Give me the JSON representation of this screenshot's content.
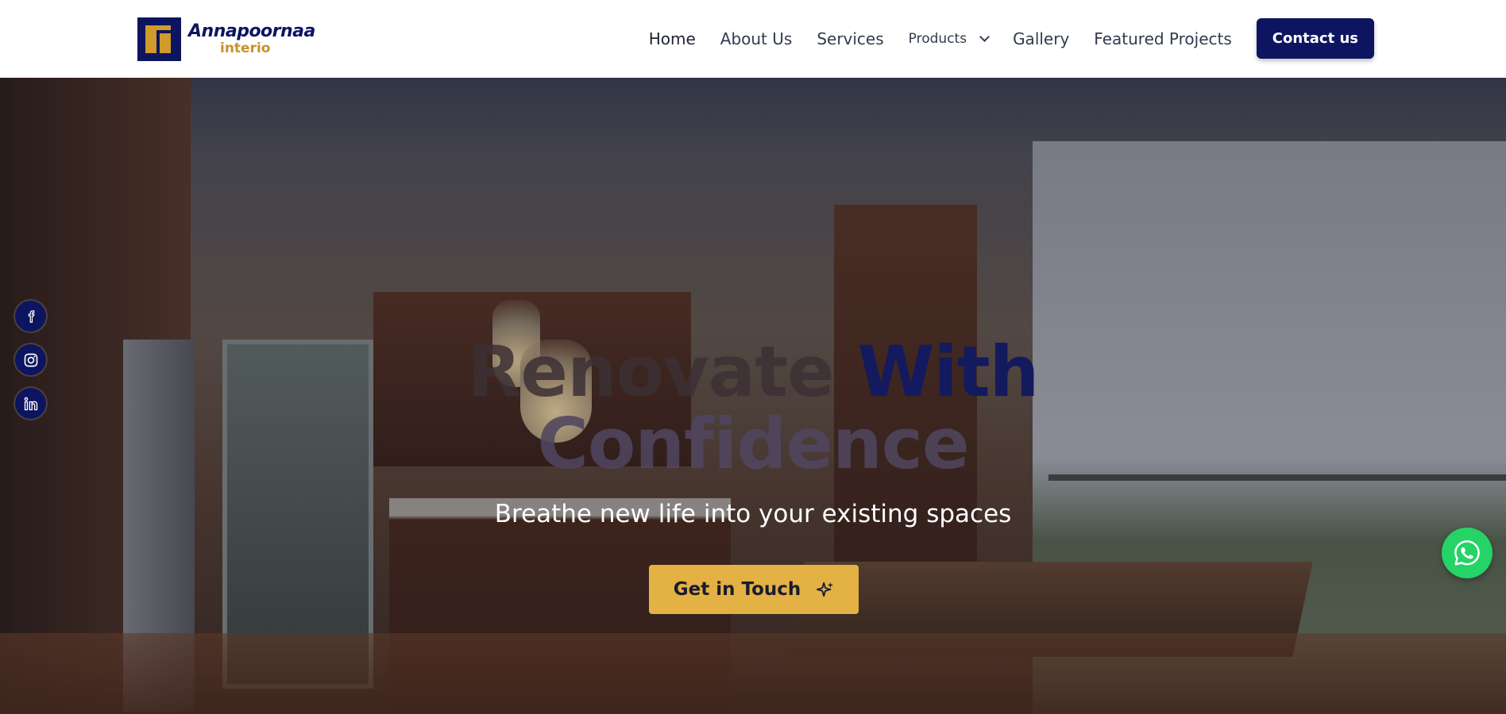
{
  "brand": {
    "name_line1": "Annapoornaa",
    "name_line2": "interio",
    "primary_color": "#0d1560",
    "accent_color": "#e3b144"
  },
  "nav": {
    "items": [
      {
        "label": "Home",
        "active": true
      },
      {
        "label": "About Us"
      },
      {
        "label": "Services"
      },
      {
        "label": "Products",
        "has_dropdown": true
      },
      {
        "label": "Gallery"
      },
      {
        "label": "Featured Projects"
      }
    ],
    "contact_label": "Contact us"
  },
  "hero": {
    "title_words_line1": [
      "Renovate",
      "With"
    ],
    "title_line2": "Confidence",
    "subtitle": "Breathe new life into your existing spaces",
    "cta_label": "Get in Touch",
    "cta_icon": "sparkle-icon"
  },
  "social": {
    "icons": [
      "facebook-icon",
      "instagram-icon",
      "linkedin-icon"
    ]
  },
  "floating": {
    "whatsapp_icon": "whatsapp-icon",
    "whatsapp_color": "#25d366"
  }
}
